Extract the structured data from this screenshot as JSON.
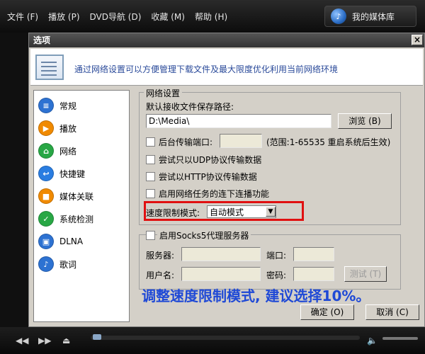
{
  "player": {
    "menu": [
      "文件 (F)",
      "播放 (P)",
      "DVD导航 (D)",
      "收藏 (M)",
      "帮助 (H)"
    ],
    "library_label": "我的媒体库",
    "controls": [
      "◀◀",
      "▶▶",
      "⏏"
    ]
  },
  "dialog": {
    "title": "选项",
    "close_glyph": "×",
    "header_text": "通过网络设置可以方便管理下载文件及最大限度优化利用当前网络环境",
    "sidebar": [
      {
        "label": "常规",
        "icon": "general-icon",
        "color": "#2d72d2",
        "glyph": "≡"
      },
      {
        "label": "播放",
        "icon": "play-icon",
        "color": "#f08a00",
        "glyph": "▶"
      },
      {
        "label": "网络",
        "icon": "network-icon",
        "color": "#28a745",
        "glyph": "⌂"
      },
      {
        "label": "快捷键",
        "icon": "shortcut-icon",
        "color": "#2a7de1",
        "glyph": "↩"
      },
      {
        "label": "媒体关联",
        "icon": "media-association-icon",
        "color": "#f08a00",
        "glyph": "■"
      },
      {
        "label": "系统检测",
        "icon": "system-check-icon",
        "color": "#28a745",
        "glyph": "✓"
      },
      {
        "label": "DLNA",
        "icon": "dlna-icon",
        "color": "#2d72d2",
        "glyph": "▣"
      },
      {
        "label": "歌词",
        "icon": "lyrics-icon",
        "color": "#2d72d2",
        "glyph": "♪"
      }
    ],
    "network": {
      "group_title": "网络设置",
      "save_path_label": "默认接收文件保存路径:",
      "save_path_value": "D:\\Media\\",
      "browse_label": "浏览 (B)",
      "background_port_label": "后台传输端口:",
      "port_value": "",
      "port_hint": "(范围:1-65535 重启系统后生效)",
      "udp_label": "尝试只以UDP协议传输数据",
      "http_label": "尝试以HTTP协议传输数据",
      "broadcast_label": "启用网络任务的连下连播功能",
      "speed_limit_label": "速度限制模式:",
      "speed_limit_value": "自动模式"
    },
    "socks": {
      "group_title": "启用Socks5代理服务器",
      "server_label": "服务器:",
      "port_label": "端口:",
      "user_label": "用户名:",
      "password_label": "密码:",
      "test_label": "测试 (T)"
    },
    "annotation": "调整速度限制模式, 建议选择10%。",
    "ok_label": "确定 (O)",
    "cancel_label": "取消 (C)"
  }
}
